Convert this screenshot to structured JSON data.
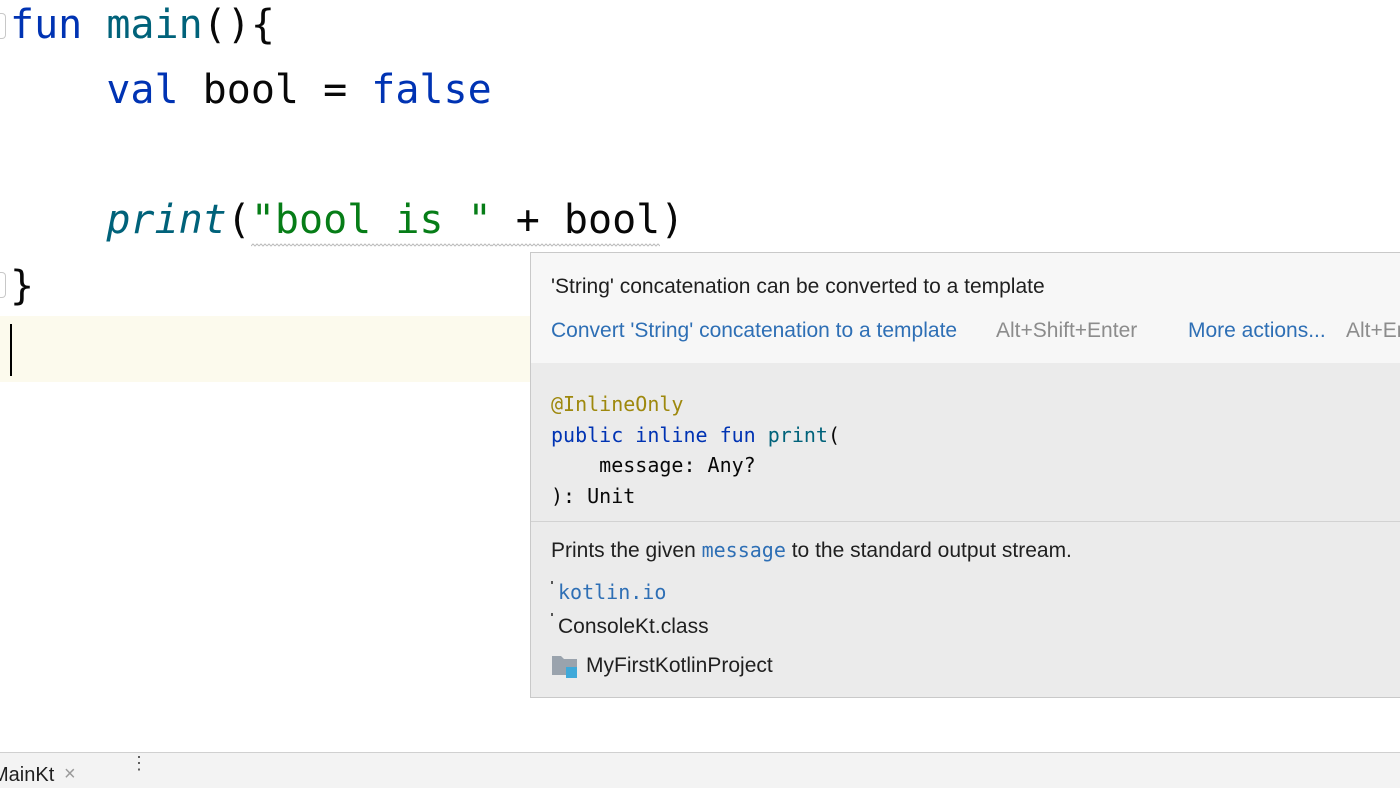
{
  "editor": {
    "lines": [
      {
        "tokens": [
          {
            "text": "fun",
            "kind": "kw"
          },
          {
            "text": " ",
            "kind": "plain"
          },
          {
            "text": "main",
            "kind": "fn-decl"
          },
          {
            "text": "(){",
            "kind": "plain"
          }
        ]
      },
      {
        "tokens": [
          {
            "text": "    ",
            "kind": "plain"
          },
          {
            "text": "val",
            "kind": "kw"
          },
          {
            "text": " bool = ",
            "kind": "plain"
          },
          {
            "text": "false",
            "kind": "kw"
          }
        ]
      },
      {
        "tokens": [
          {
            "text": "    ",
            "kind": "plain"
          },
          {
            "text": "print",
            "kind": "fn-call"
          },
          {
            "text": "(",
            "kind": "plain"
          },
          {
            "text": "\"bool is \"",
            "kind": "str warn"
          },
          {
            "text": " + bool",
            "kind": "plain warn"
          },
          {
            "text": ")",
            "kind": "plain"
          }
        ]
      },
      {
        "tokens": [
          {
            "text": "}",
            "kind": "plain"
          }
        ]
      }
    ]
  },
  "popup": {
    "intent": {
      "title": "'String' concatenation can be converted to a template",
      "action_label": "Convert 'String' concatenation to a template",
      "action_shortcut": "Alt+Shift+Enter",
      "more_label": "More actions...",
      "more_shortcut": "Alt+Enter"
    },
    "doc": {
      "signature": {
        "annotation": "@InlineOnly",
        "kw_public": "public",
        "kw_inline": "inline",
        "kw_fun": "fun",
        "name": "print",
        "open_paren": "(",
        "param": "    message: Any?",
        "close": "): Unit"
      },
      "description_before": "Prints the given ",
      "description_code": "message",
      "description_after": " to the standard output stream.",
      "package": "kotlin.io",
      "class_file": "ConsoleKt.class",
      "project": "MyFirstKotlinProject"
    }
  },
  "bottom_bar": {
    "tab_label": "MainKt",
    "close_glyph": "×",
    "more_glyph": "⋮"
  },
  "icons": {
    "project": "folder-module-icon",
    "close": "close-icon",
    "more": "more-vertical-icon"
  }
}
